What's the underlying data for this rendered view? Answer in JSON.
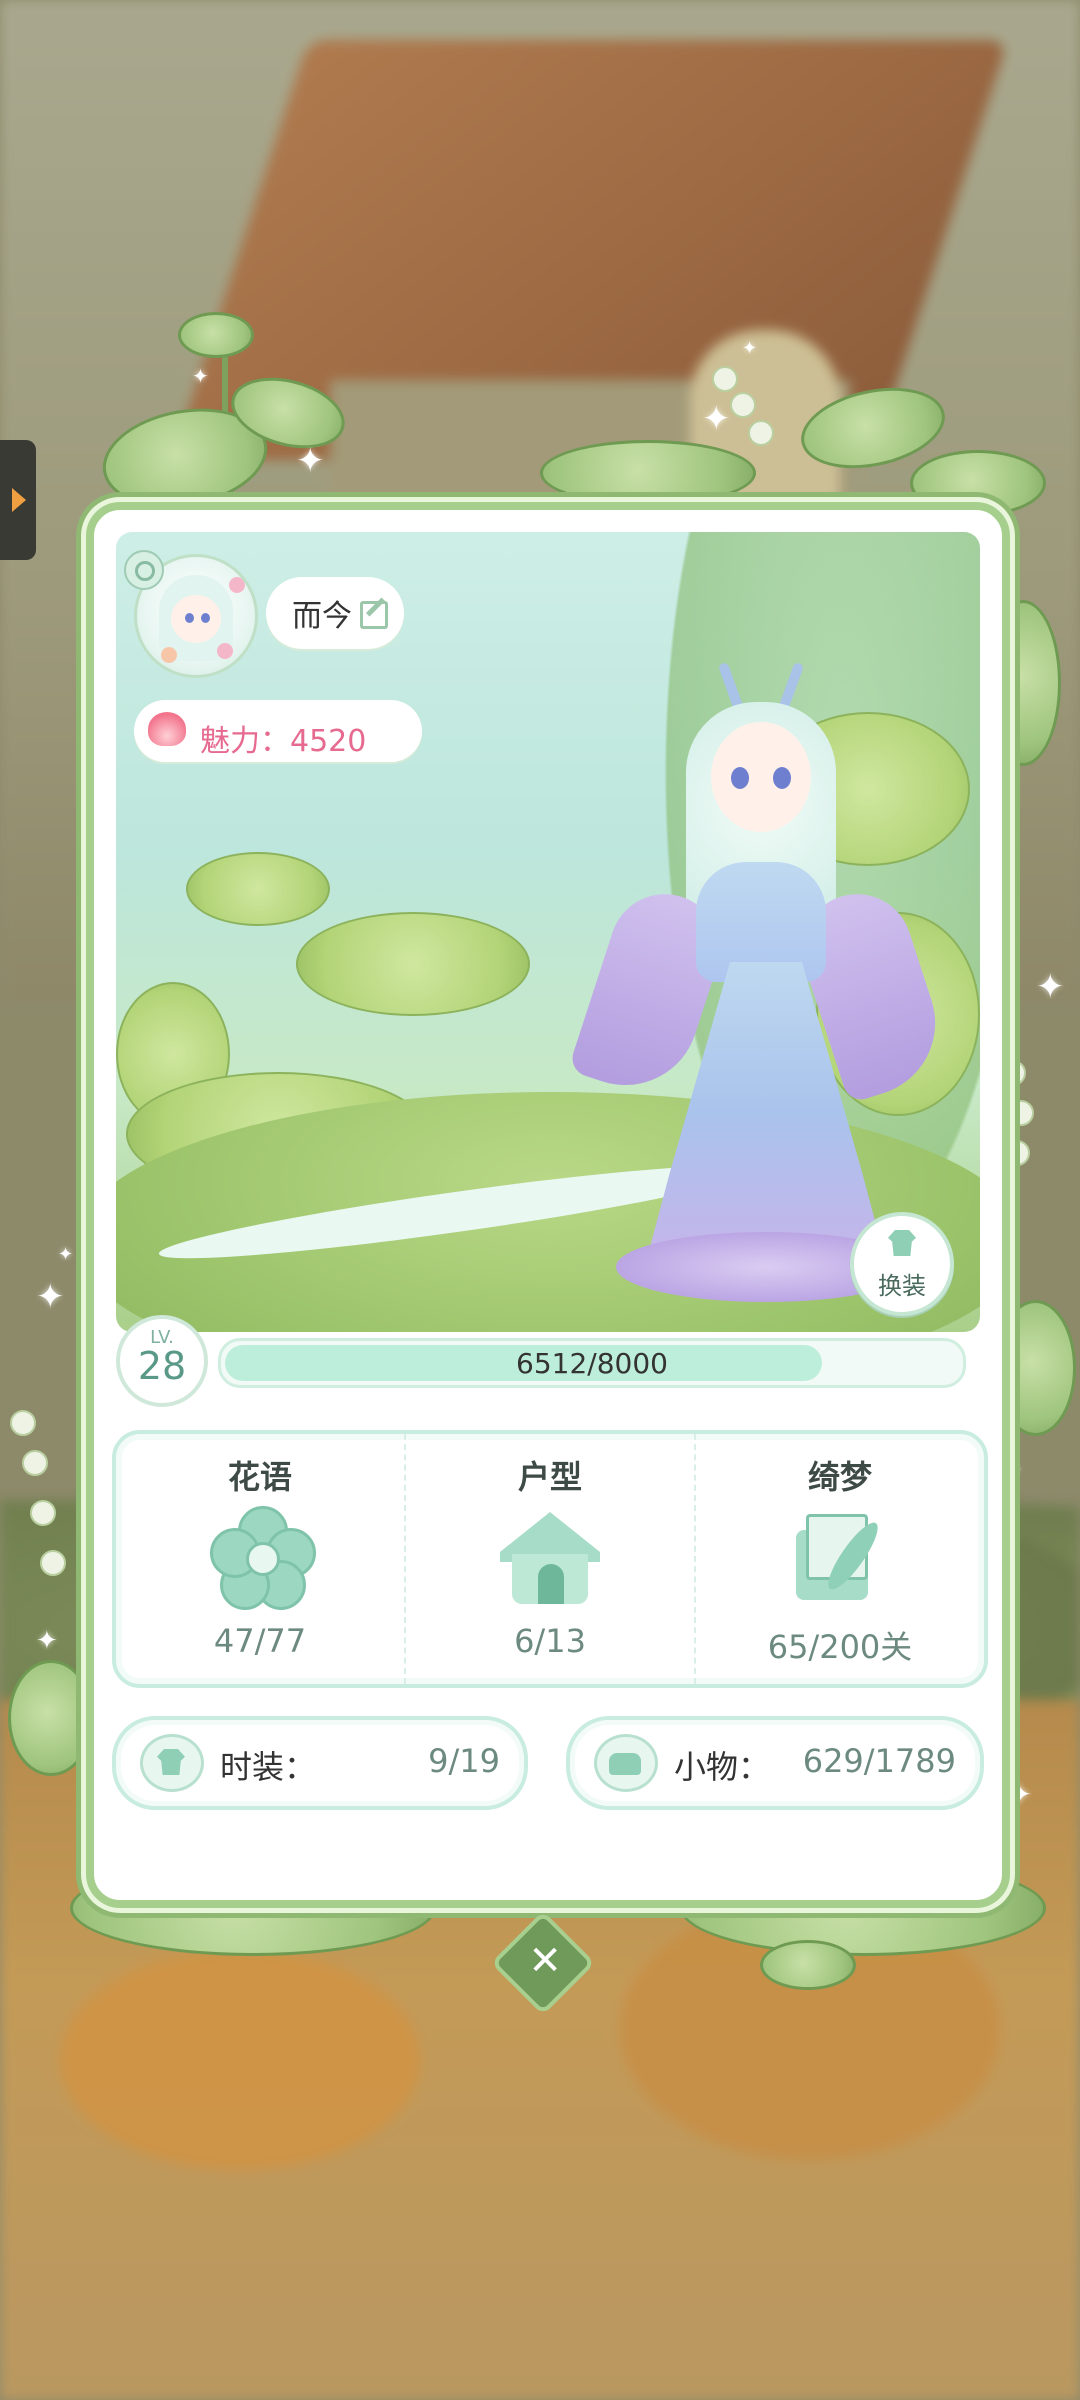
{
  "profile": {
    "name": "而今",
    "charm_label": "魅力：4520"
  },
  "level": {
    "prefix": "LV.",
    "value": "28",
    "exp_text": "6512/8000",
    "exp_progress": 0.814
  },
  "outfit_button": {
    "label": "换装"
  },
  "stats": [
    {
      "title": "花语",
      "value": "47/77",
      "icon": "flower-icon"
    },
    {
      "title": "户型",
      "value": "6/13",
      "icon": "house-icon"
    },
    {
      "title": "绮梦",
      "value": "65/200关",
      "icon": "letter-icon"
    }
  ],
  "collections": {
    "fashion": {
      "label": "时装：",
      "value": "9/19",
      "icon": "shirt-icon"
    },
    "items": {
      "label": "小物：",
      "value": "629/1789",
      "icon": "sofa-icon"
    }
  },
  "close_icon": "close-icon",
  "colors": {
    "accent_green": "#a6cf8e",
    "mint": "#bdeedc",
    "charm_pink": "#e66a8f"
  }
}
